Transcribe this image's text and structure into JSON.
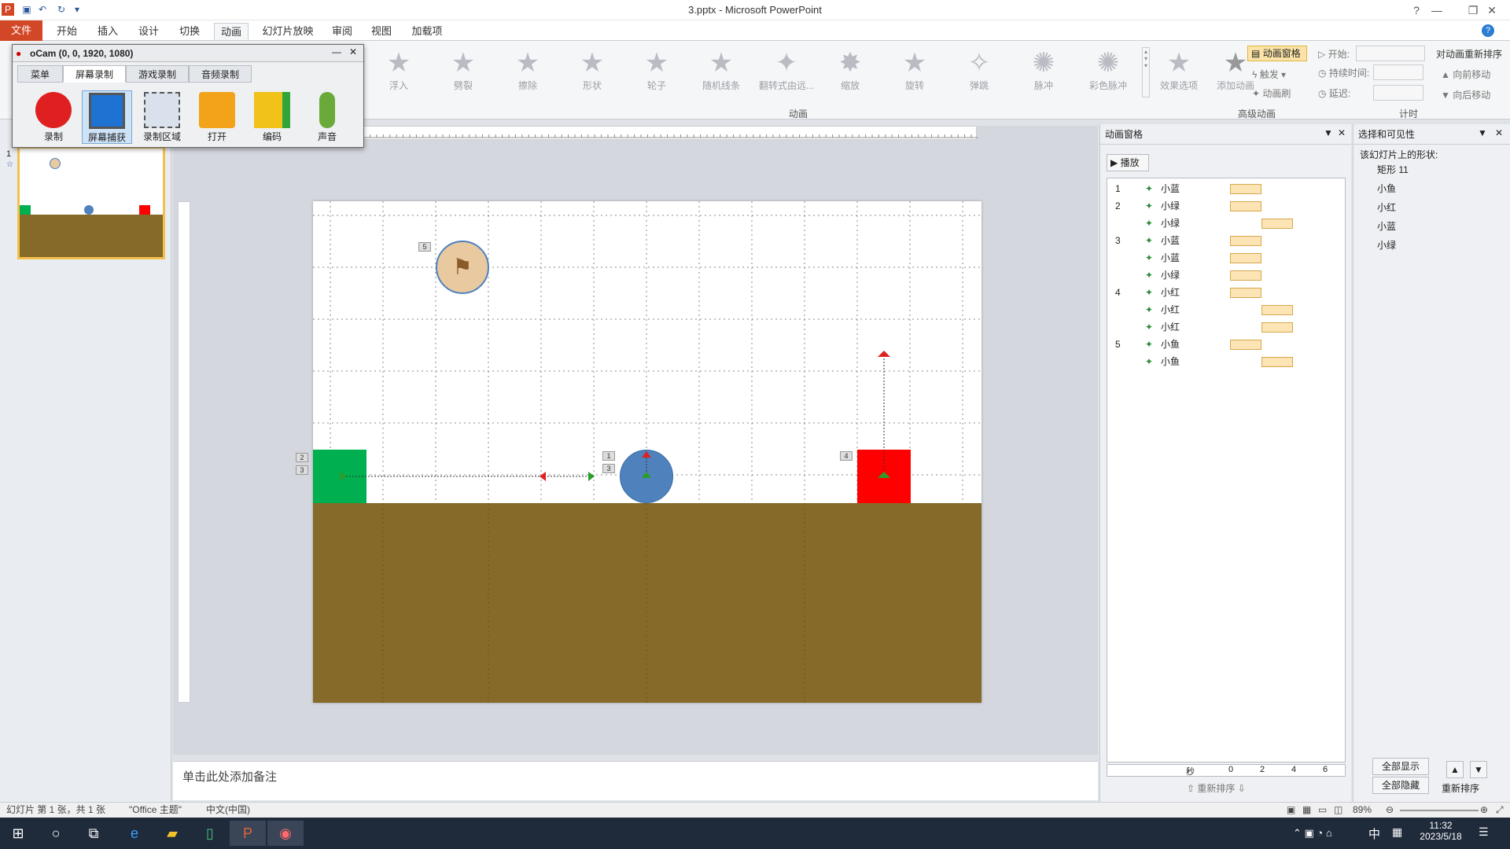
{
  "window": {
    "title": "3.pptx - Microsoft PowerPoint"
  },
  "tabs": [
    "文件",
    "开始",
    "插入",
    "设计",
    "切换",
    "动画",
    "幻灯片放映",
    "审阅",
    "视图",
    "加载项"
  ],
  "ribbon": {
    "effects": [
      "浮入",
      "劈裂",
      "擦除",
      "形状",
      "轮子",
      "随机线条",
      "翻转式由远...",
      "缩放",
      "旋转",
      "弹跳",
      "脉冲",
      "彩色脉冲"
    ],
    "effect_options": "效果选项",
    "group_anim": "动画",
    "add_anim": "添加动画",
    "anim_pane": "动画窗格",
    "trigger": "触发",
    "painter": "动画刷",
    "group_adv": "高级动画",
    "start": "开始:",
    "duration": "持续时间:",
    "delay": "延迟:",
    "group_timing": "计时",
    "reorder": "对动画重新排序",
    "move_earlier": "向前移动",
    "move_later": "向后移动"
  },
  "ocam": {
    "title": "oCam (0, 0, 1920, 1080)",
    "tabs": [
      "菜单",
      "屏幕录制",
      "游戏录制",
      "音频录制"
    ],
    "buttons": [
      "录制",
      "屏幕捕获",
      "录制区域",
      "打开",
      "编码",
      "声音"
    ]
  },
  "slides_panel": {
    "num": "1"
  },
  "slide": {
    "tags": [
      "5",
      "2",
      "3",
      "1",
      "3",
      "4"
    ]
  },
  "notes": {
    "placeholder": "单击此处添加备注"
  },
  "anim_pane": {
    "title": "动画窗格",
    "play": "播放",
    "rows": [
      {
        "n": "1",
        "name": "小蓝",
        "start": 0.0,
        "len": 0.5
      },
      {
        "n": "2",
        "name": "小绿",
        "start": 0.0,
        "len": 0.5
      },
      {
        "n": "",
        "name": "小绿",
        "start": 0.5,
        "len": 0.5
      },
      {
        "n": "3",
        "name": "小蓝",
        "start": 0.0,
        "len": 0.5
      },
      {
        "n": "",
        "name": "小蓝",
        "start": 0.0,
        "len": 0.5
      },
      {
        "n": "",
        "name": "小绿",
        "start": 0.0,
        "len": 0.5
      },
      {
        "n": "4",
        "name": "小红",
        "start": 0.0,
        "len": 0.5
      },
      {
        "n": "",
        "name": "小红",
        "start": 0.5,
        "len": 0.5
      },
      {
        "n": "",
        "name": "小红",
        "start": 0.5,
        "len": 0.5
      },
      {
        "n": "5",
        "name": "小鱼",
        "start": 0.0,
        "len": 0.5
      },
      {
        "n": "",
        "name": "小鱼",
        "start": 0.5,
        "len": 0.5
      }
    ],
    "timeline_unit": "秒",
    "timeline_ticks": [
      "0",
      "2",
      "4",
      "6"
    ],
    "reorder": "重新排序"
  },
  "sel_pane": {
    "title": "选择和可见性",
    "subtitle": "该幻灯片上的形状:",
    "items": [
      "矩形 11",
      "小鱼",
      "小红",
      "小蓝",
      "小绿"
    ],
    "show_all": "全部显示",
    "hide_all": "全部隐藏",
    "reorder": "重新排序"
  },
  "status": {
    "slide": "幻灯片 第 1 张，共 1 张",
    "theme": "\"Office 主题\"",
    "lang": "中文(中国)",
    "zoom": "89%"
  },
  "taskbar": {
    "ime": "中",
    "time": "11:32",
    "date": "2023/5/18"
  }
}
